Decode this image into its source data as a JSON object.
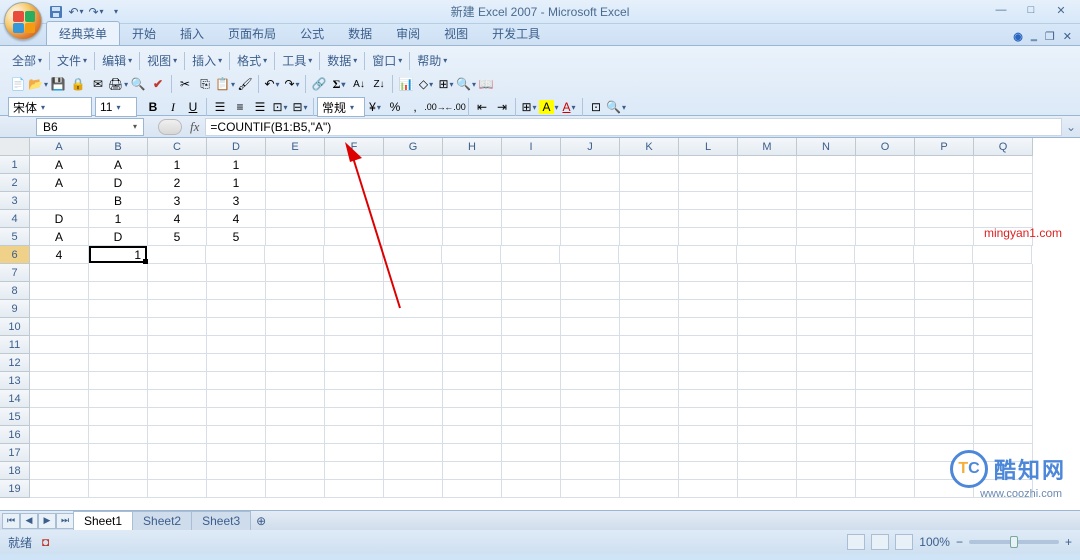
{
  "title": "新建 Excel 2007 - Microsoft Excel",
  "ribbon_tabs": [
    "经典菜单",
    "开始",
    "插入",
    "页面布局",
    "公式",
    "数据",
    "审阅",
    "视图",
    "开发工具"
  ],
  "active_ribbon_tab": 0,
  "menus": [
    "全部",
    "文件",
    "编辑",
    "视图",
    "插入",
    "格式",
    "工具",
    "数据",
    "窗口",
    "帮助"
  ],
  "font": {
    "name": "宋体",
    "size": "11",
    "style_label": "常规"
  },
  "namebox": "B6",
  "formula": "=COUNTIF(B1:B5,\"A\")",
  "columns": [
    "A",
    "B",
    "C",
    "D",
    "E",
    "F",
    "G",
    "H",
    "I",
    "J",
    "K",
    "L",
    "M",
    "N",
    "O",
    "P",
    "Q"
  ],
  "rows_count": 19,
  "active_row": 6,
  "cells": {
    "1": {
      "A": "A",
      "B": "A",
      "C": "1",
      "D": "1"
    },
    "2": {
      "A": "A",
      "B": "D",
      "C": "2",
      "D": "1"
    },
    "3": {
      "A": "",
      "B": "B",
      "C": "3",
      "D": "3"
    },
    "4": {
      "A": "D",
      "B": "1",
      "C": "4",
      "D": "4"
    },
    "5": {
      "A": "A",
      "B": "D",
      "C": "5",
      "D": "5"
    },
    "6": {
      "A": "4",
      "B": "1"
    }
  },
  "selected_cell": {
    "row": 6,
    "col": "B"
  },
  "sheets": [
    "Sheet1",
    "Sheet2",
    "Sheet3"
  ],
  "active_sheet": 0,
  "status": "就绪",
  "zoom": "100%",
  "watermark": "mingyan1.com",
  "logo_text": "酷知网",
  "logo_url": "www.coozhi.com",
  "winbtns": {
    "min": "—",
    "max": "□",
    "close": "✕"
  }
}
